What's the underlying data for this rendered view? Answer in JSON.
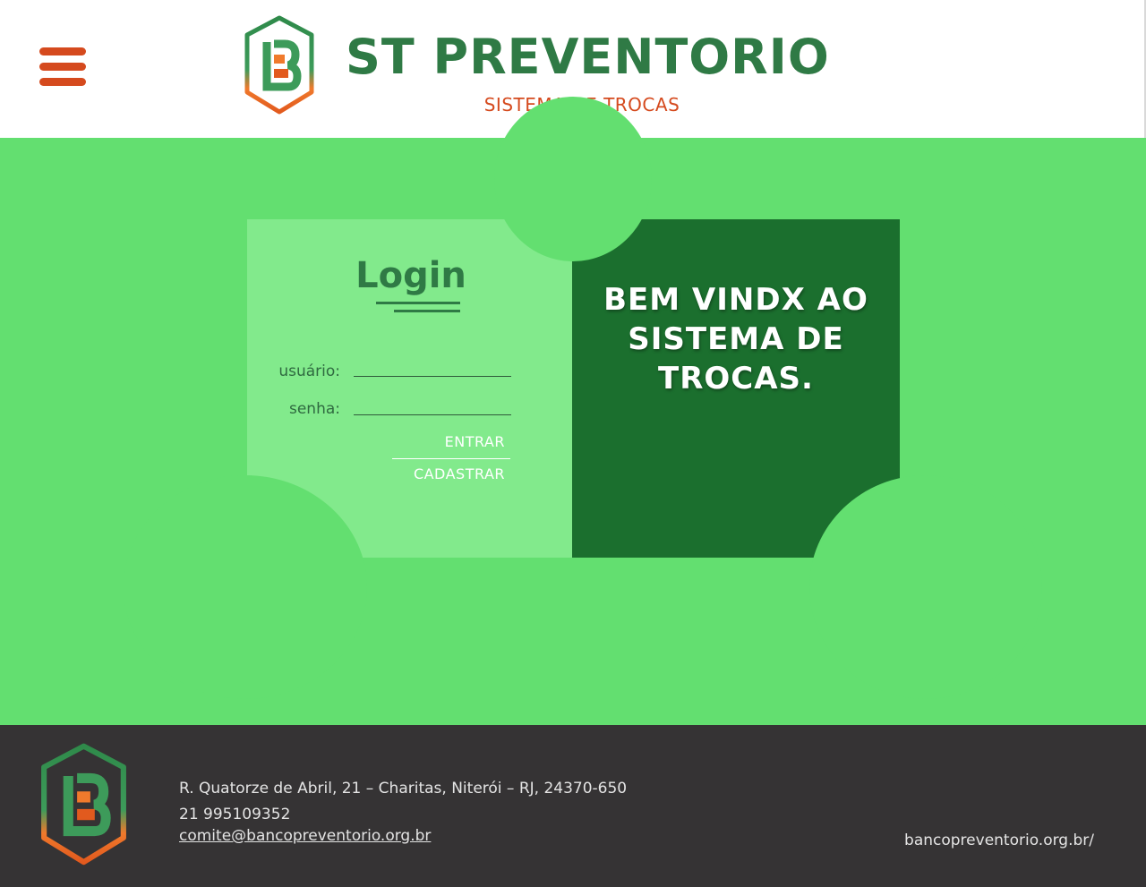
{
  "header": {
    "title": "ST PREVENTORIO",
    "subtitle": "SISTEMA DE TROCAS",
    "menu_icon": "hamburger-menu-icon",
    "logo_icon": "hexagon-b-logo-icon"
  },
  "login": {
    "title": "Login",
    "user_label": "usuário:",
    "user_value": "",
    "password_label": "senha:",
    "password_value": "",
    "enter_label": "ENTRAR",
    "register_label": "CADASTRAR"
  },
  "welcome": {
    "text": "BEM VINDX AO SISTEMA DE TROCAS."
  },
  "footer": {
    "address": "R. Quatorze de Abril, 21 – Charitas, Niterói – RJ, 24370-650",
    "phone": "21 995109352",
    "email": "comite@bancopreventorio.org.br",
    "website": "bancopreventorio.org.br/"
  },
  "colors": {
    "brand_green": "#2f7a45",
    "brand_orange": "#d54a1e",
    "page_bg": "#63df70",
    "card_light": "#82ea8c",
    "card_dark": "#1b6f2e",
    "footer_bg": "#353334"
  }
}
